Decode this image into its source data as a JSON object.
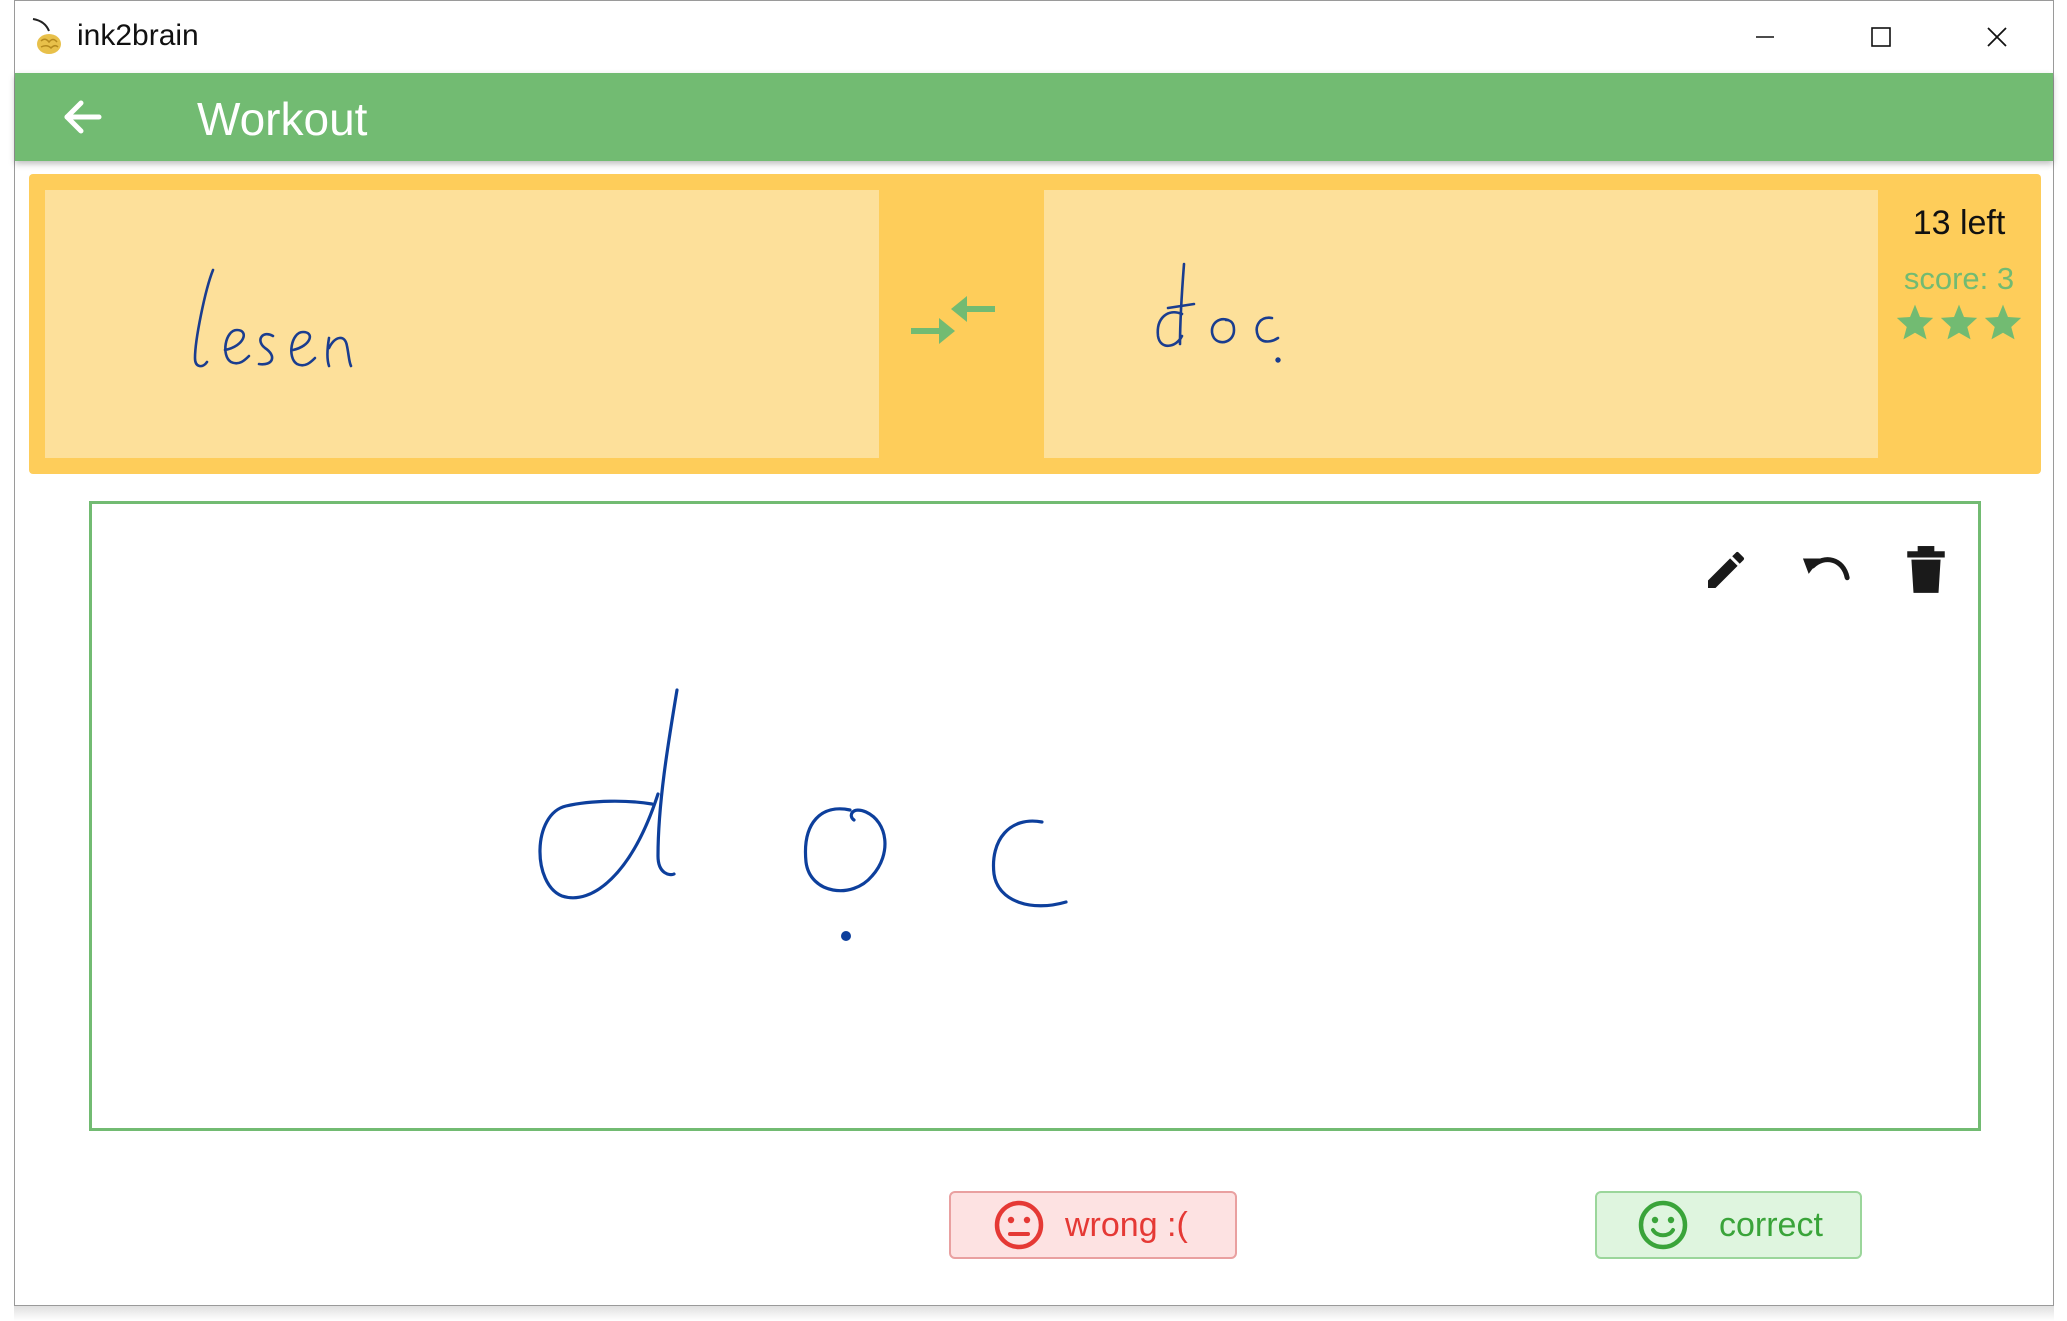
{
  "window": {
    "title": "ink2brain",
    "controls": [
      "minimize",
      "maximize",
      "close"
    ]
  },
  "appbar": {
    "title": "Workout",
    "back_icon": "arrow-left-icon"
  },
  "card": {
    "front_word": "lesen",
    "back_word": "đọc",
    "swap_icon": "swap-arrows-icon",
    "remaining": "13 left",
    "score": "score: 3",
    "stars": 3
  },
  "canvas": {
    "ink_word": "đọc",
    "tools": [
      "pencil-icon",
      "undo-icon",
      "trash-icon"
    ]
  },
  "answers": {
    "wrong_label": "wrong :(",
    "correct_label": "correct"
  },
  "colors": {
    "accent_green": "#72bb72",
    "card_yellow": "#fecd5a",
    "card_panel": "#fde09a",
    "ink_blue": "#0d47a1",
    "wrong_red": "#e53935",
    "correct_green": "#3aa43a"
  }
}
